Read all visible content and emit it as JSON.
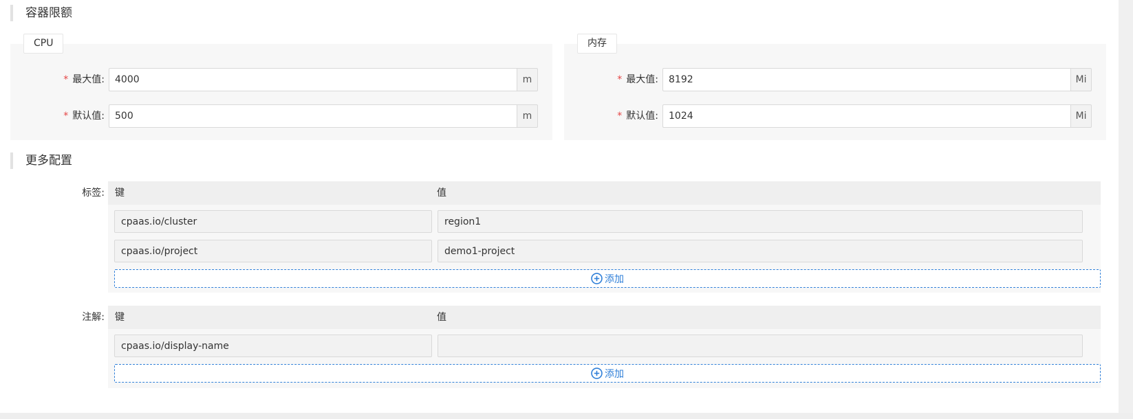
{
  "container_limits": {
    "title": "容器限额",
    "cpu": {
      "tab": "CPU",
      "max": {
        "label": "最大值:",
        "required_mark": "*",
        "value": "4000",
        "unit": "m"
      },
      "default": {
        "label": "默认值:",
        "required_mark": "*",
        "value": "500",
        "unit": "m"
      }
    },
    "memory": {
      "tab": "内存",
      "max": {
        "label": "最大值:",
        "required_mark": "*",
        "value": "8192",
        "unit": "Mi"
      },
      "default": {
        "label": "默认值:",
        "required_mark": "*",
        "value": "1024",
        "unit": "Mi"
      }
    }
  },
  "more_config": {
    "title": "更多配置",
    "labels": {
      "label": "标签:",
      "key_header": "键",
      "value_header": "值",
      "rows": [
        {
          "key": "cpaas.io/cluster",
          "value": "region1"
        },
        {
          "key": "cpaas.io/project",
          "value": "demo1-project"
        }
      ],
      "add_label": "添加"
    },
    "annotations": {
      "label": "注解:",
      "key_header": "键",
      "value_header": "值",
      "rows": [
        {
          "key": "cpaas.io/display-name",
          "value": ""
        }
      ],
      "add_label": "添加"
    }
  },
  "colors": {
    "accent": "#2f7fd8",
    "required": "#e54545"
  }
}
